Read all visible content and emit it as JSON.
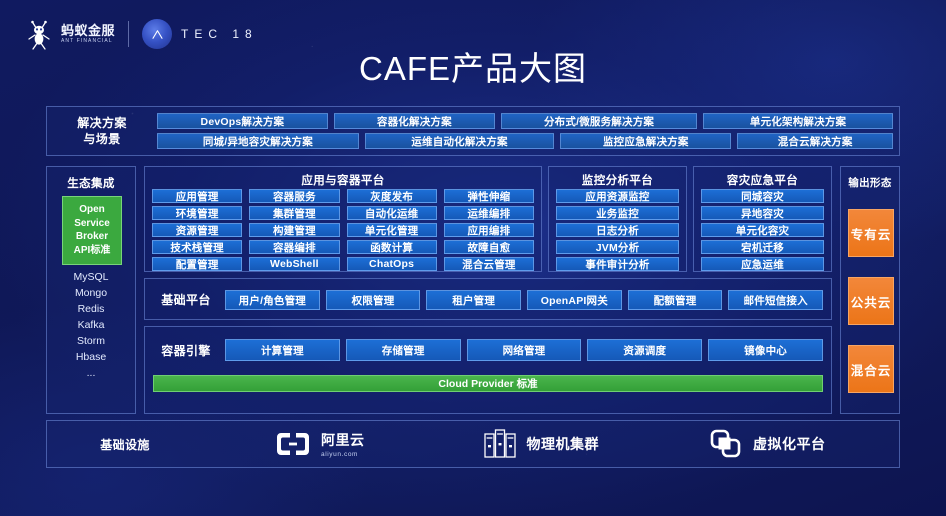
{
  "header": {
    "brand_cn": "蚂蚁金服",
    "brand_en": "ANT FINANCIAL",
    "event": "TEC 18",
    "event_mark": "A"
  },
  "title": "CAFE产品大图",
  "colors": {
    "background": "#101a60",
    "chip_blue": "#1d6fd6",
    "solution_blue": "#2064c4",
    "green": "#3ba93f",
    "cloud_provider_green": "#4ab54c",
    "orange": "#ef7d23",
    "panel_border": "#82a0f0"
  },
  "solutions": {
    "label": "解决方案\n与场景",
    "label_line1": "解决方案",
    "label_line2": "与场景",
    "rows": [
      [
        "DevOps解决方案",
        "容器化解决方案",
        "分布式/微服务解决方案",
        "单元化架构解决方案"
      ],
      [
        "同城/异地容灾解决方案",
        "运维自动化解决方案",
        "监控应急解决方案",
        "混合云解决方案"
      ]
    ]
  },
  "ecosystem": {
    "title": "生态集成",
    "standard_lines": [
      "Open",
      "Service",
      "Broker",
      "API标准"
    ],
    "items": [
      "MySQL",
      "Mongo",
      "Redis",
      "Kafka",
      "Storm",
      "Hbase",
      "..."
    ]
  },
  "app_platform": {
    "title": "应用与容器平台",
    "items": [
      "应用管理",
      "容器服务",
      "灰度发布",
      "弹性伸缩",
      "环境管理",
      "集群管理",
      "自动化运维",
      "运维编排",
      "资源管理",
      "构建管理",
      "单元化管理",
      "应用编排",
      "技术栈管理",
      "容器编排",
      "函数计算",
      "故障自愈",
      "配置管理",
      "WebShell",
      "ChatOps",
      "混合云管理"
    ]
  },
  "monitor_platform": {
    "title": "监控分析平台",
    "items": [
      "应用资源监控",
      "业务监控",
      "日志分析",
      "JVM分析",
      "事件审计分析"
    ]
  },
  "dr_platform": {
    "title": "容灾应急平台",
    "items": [
      "同城容灾",
      "异地容灾",
      "单元化容灾",
      "宕机迁移",
      "应急运维"
    ]
  },
  "base_platform": {
    "label": "基础平台",
    "items": [
      "用户/角色管理",
      "权限管理",
      "租户管理",
      "OpenAPI网关",
      "配额管理",
      "邮件短信接入"
    ]
  },
  "container_engine": {
    "label": "容器引擎",
    "items": [
      "计算管理",
      "存储管理",
      "网络管理",
      "资源调度",
      "镜像中心"
    ],
    "cloud_provider_bar": "Cloud Provider 标准"
  },
  "output_forms": {
    "title": "输出形态",
    "items": [
      "专有云",
      "公共云",
      "混合云"
    ]
  },
  "infrastructure": {
    "label": "基础设施",
    "items": [
      {
        "name": "阿里云",
        "sub": "aliyun.com",
        "icon": "aliyun-logo-icon"
      },
      {
        "name": "物理机集群",
        "sub": "",
        "icon": "server-rack-icon"
      },
      {
        "name": "虚拟化平台",
        "sub": "",
        "icon": "virtualization-icon"
      }
    ]
  }
}
